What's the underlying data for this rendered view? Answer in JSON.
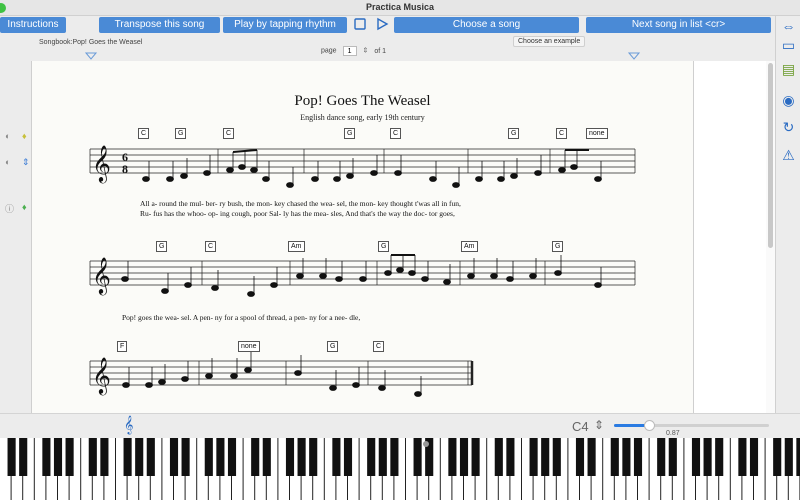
{
  "window": {
    "title": "Practica Musica"
  },
  "toolbar": {
    "instructions": "Instructions",
    "transpose": "Transpose this song",
    "play_tap": "Play by tapping rhythm",
    "choose_song": "Choose a song",
    "next_song": "Next song in list <cr>"
  },
  "tooltip": "Choose an example",
  "songbook": "Songbook:Pop! Goes the Weasel",
  "page": {
    "label": "page",
    "value": "1",
    "of_label": "of 1"
  },
  "score": {
    "title": "Pop! Goes The Weasel",
    "subtitle": "English dance song, early 19th century",
    "time_signature": "6/8",
    "systems": [
      {
        "chords": [
          "C",
          "G",
          "C",
          "G",
          "C",
          "G",
          "C",
          "none"
        ],
        "lyrics_1": "All  a- round the  mul- ber- ry bush, the  mon- key chased the  wea-  sel, the  mon- key thought t'was all  in  fun,",
        "lyrics_2": "Ru-  fus has  the  whoo- op- ing cough, poor Sal- ly has  the  mea-  sles, And  that's the way  the  doc-  tor goes,"
      },
      {
        "chords": [
          "G",
          "C",
          "Am",
          "G",
          "Am",
          "G"
        ],
        "lyrics_1": "Pop!  goes  the  wea-  sel.  A  pen-  ny  for  a  spool of  thread, a  pen-  ny  for  a  nee-  dle,"
      },
      {
        "chords": [
          "F",
          "none",
          "G",
          "C"
        ],
        "lyrics_1": ""
      }
    ]
  },
  "controls": {
    "note": "C4",
    "slider_value": 0.87,
    "slider_label": "0.87"
  },
  "icons": {
    "play": "play-icon",
    "stop": "stop-icon",
    "treble": "treble-clef-icon",
    "stepper": "stepper-icon"
  },
  "colors": {
    "accent": "#4a8ad6",
    "icon": "#2a6bc2"
  }
}
